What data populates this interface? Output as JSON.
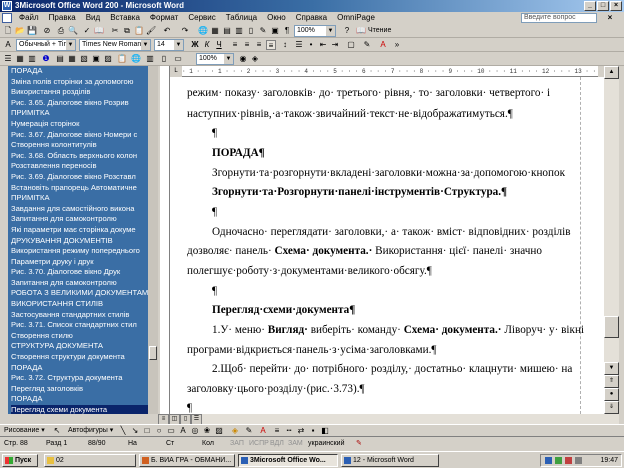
{
  "window": {
    "title": "3Microsoft Office Word 200 - Microsoft Word",
    "icon_text": "W",
    "controls": [
      "_",
      "□",
      "×"
    ]
  },
  "menu": {
    "items": [
      "Файл",
      "Правка",
      "Вид",
      "Вставка",
      "Формат",
      "Сервис",
      "Таблица",
      "Окно",
      "Справка",
      "OmniPage"
    ],
    "help_placeholder": "Введите вопрос",
    "doc_close": "×"
  },
  "toolbar": {
    "zoom": "100%",
    "reading_label": "Чтение",
    "style": "Обычный + Time",
    "font": "Times New Roman",
    "size": "14",
    "bold": "Ж",
    "italic": "К",
    "underline": "Ч",
    "zoom2": "100%"
  },
  "navigation": {
    "items": [
      "ПОРАДА",
      "Зміна полів сторінки за допомогою",
      "Використання розділів",
      "Рис. 3.65. Діалогове вікно Розрив",
      "ПРИМІТКА",
      "Нумерація сторінок",
      "Рис. 3.67. Діалогове вікно Номери с",
      "Створення колонтитулів",
      "Рис. 3.68. Область верхнього колон",
      "Розставлення переносів",
      "Рис. 3.69. Діалогове вікно Розставл",
      "Встановіть прапорець Автоматичне",
      "ПРИМІТКА",
      "Завдання для самостійного викона",
      "Запитання для самоконтролю",
      "Які параметри має сторінка докуме",
      "ДРУКУВАННЯ ДОКУМЕНТІВ",
      "Використання режиму попереднього",
      "Параметри друку і друк",
      "Рис. 3.70. Діалогове вікно Друк",
      "Запитання для самоконтролю",
      "РОБОТА З ВЕЛИКИМИ ДОКУМЕНТАМ",
      "ВИКОРИСТАННЯ СТИЛІВ",
      "Застосування стандартних стилів",
      "Рис. 3.71. Список стандартних стил",
      "Створення стилю",
      "СТРУКТУРА ДОКУМЕНТА",
      "Створення структури документа",
      "ПОРАДА",
      "Рис. 3.72. Структура документа",
      "Перегляд заголовків",
      "ПОРАДА",
      "Перегляд схеми документа",
      "Створення змісту"
    ],
    "selected_index": 32
  },
  "ruler": {
    "text": "· 1 · · · 1 · · · 2 · · · 3 · · · 4 · · · 5 · · · 6 · · · 7 · · · 8 · · · 9 · · · 10 · · · 11 · · · 12 · · · 13 · · · 14 · · · 15 · · · 16 · · · 17"
  },
  "document": {
    "lines": [
      "режим· показу· заголовків· до· третього· рівня,· то· заголовки· четвертого· і",
      "наступних·рівнів,·а·також·звичайний·текст·не·відображатимуться.¶",
      "¶",
      "ПОРАДА¶",
      "Згорнути·та·розгорнути·вкладені·заголовки·можна·за·допомогою·кнопок",
      "Згорнути·та·Розгорнути·панелі·інструментів·Структура.¶",
      "¶",
      "Одночасно· переглядати· заголовки,· а· також· вміст· відповідних· розділів",
      "дозволяє· панель· Схема· документа.· Використання· цієї· панелі· значно",
      "полегшує·роботу·з·документами·великого·обсягу.¶",
      "¶",
      "Перегляд·схеми·документа¶",
      "1.У· меню· Вигляд· виберіть· команду· Схема· документа.· Ліворуч· у· вікні",
      "програми·відкриється·панель·з·усіма·заголовками.¶",
      "2.Щоб· перейти· до· потрібного· розділу,· достатньо· клацнути· мишею· на",
      "заголовку·цього·розділу·(рис.·3.73).¶",
      "¶"
    ],
    "bold_fragments": {
      "l5_a": "Згорнути·та·Розгорнути",
      "l5_b": "·панелі·інструментів·",
      "l5_c": "Структура.¶",
      "l8_a": "дозволяє· панель· ",
      "l8_b": "Схема· документа.·",
      "l8_c": " Використання· цієї· панелі· значно",
      "l12_a": "1.У· меню· ",
      "l12_b": "Вигляд·",
      "l12_c": " виберіть· команду· ",
      "l12_d": "Схема· документа.·",
      "l12_e": " Ліворуч· у· вікні"
    }
  },
  "drawing": {
    "draw_label": "Рисование ▾",
    "autoshapes_label": "Автофигуры ▾"
  },
  "status": {
    "page": "Стр.  88",
    "section": "Разд  1",
    "pages": "88/90",
    "at": "На",
    "line": "Ст",
    "col": "Кол",
    "rec": "ЗАП",
    "trk": "ИСПР",
    "ext": "ВДЛ",
    "ovr": "ЗАМ",
    "lang": "украинский"
  },
  "taskbar": {
    "start": "Пуск",
    "buttons": [
      "02",
      "Б. ВИА ГРА - ОБМАНИ...",
      "3Microsoft Office Wo...",
      "12 - Microsoft Word"
    ],
    "active_index": 2,
    "clock": "19:47"
  },
  "colors": {
    "title_gradient_start": "#0a246a",
    "nav_background": "#3a6ea5",
    "selection": "#0a246a",
    "chrome": "#d4d0c8"
  }
}
